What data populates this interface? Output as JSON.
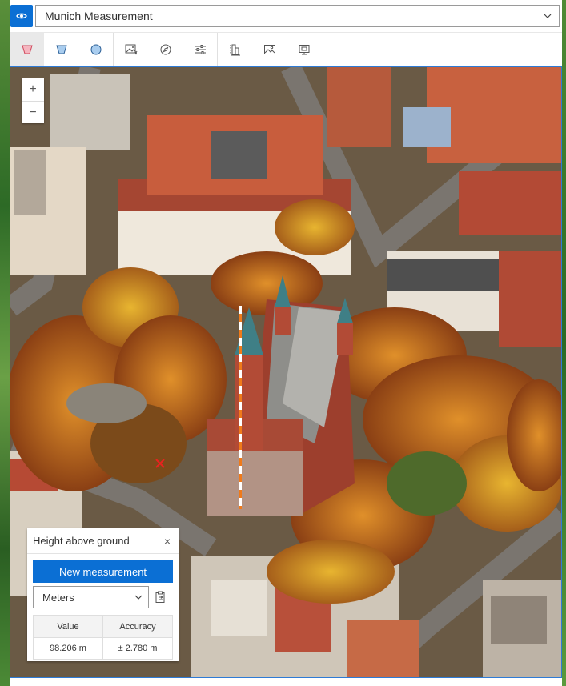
{
  "layer": {
    "visibility_icon": "eye-icon",
    "name": "Munich Measurement",
    "dropdown_icon": "chevron-down-icon"
  },
  "toolbar": {
    "tools": [
      {
        "name": "area-measure",
        "icon": "trapezoid-icon",
        "active": true
      },
      {
        "name": "slice",
        "icon": "trapezoid-inverted-icon",
        "active": false
      },
      {
        "name": "circle",
        "icon": "circle-icon",
        "active": false
      },
      {
        "name": "image-layer",
        "icon": "image-icon",
        "active": false
      },
      {
        "name": "compass",
        "icon": "compass-icon",
        "active": false
      },
      {
        "name": "settings",
        "icon": "sliders-icon",
        "active": false
      },
      {
        "name": "height-measure",
        "icon": "building-height-icon",
        "active": false
      },
      {
        "name": "basemap",
        "icon": "picture-icon",
        "active": false
      },
      {
        "name": "presentation",
        "icon": "monitor-icon",
        "active": false
      }
    ]
  },
  "map": {
    "zoom_in": "+",
    "zoom_out": "−"
  },
  "widget": {
    "title": "Height above ground",
    "close": "×",
    "new_button": "New measurement",
    "unit": "Meters",
    "table": {
      "headers": [
        "Value",
        "Accuracy"
      ],
      "row": [
        "98.206 m",
        "± 2.780 m"
      ]
    }
  },
  "colors": {
    "accent": "#0b6fd4",
    "measure_line": "#f07a1a"
  }
}
